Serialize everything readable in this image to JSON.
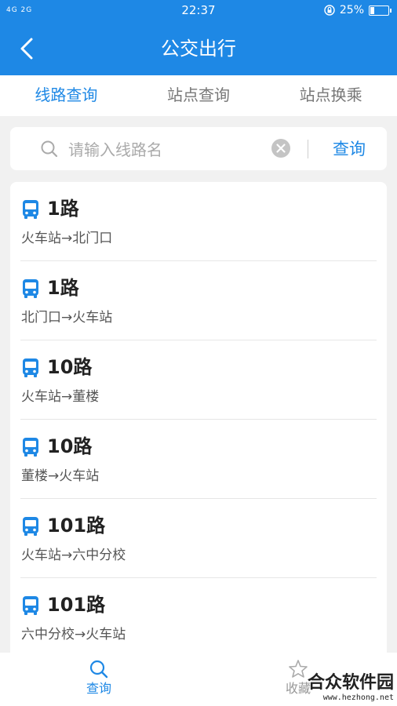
{
  "status_bar": {
    "signal_text": "4G 2G",
    "time": "22:37",
    "battery_percent_text": "25%",
    "battery_level": 0.25
  },
  "header": {
    "title": "公交出行"
  },
  "tabs": [
    {
      "label": "线路查询",
      "active": true
    },
    {
      "label": "站点查询",
      "active": false
    },
    {
      "label": "站点换乘",
      "active": false
    }
  ],
  "search": {
    "placeholder": "请输入线路名",
    "value": "",
    "button_label": "查询"
  },
  "routes": [
    {
      "name": "1路",
      "direction": "火车站→北门口"
    },
    {
      "name": "1路",
      "direction": "北门口→火车站"
    },
    {
      "name": "10路",
      "direction": "火车站→董楼"
    },
    {
      "name": "10路",
      "direction": "董楼→火车站"
    },
    {
      "name": "101路",
      "direction": "火车站→六中分校"
    },
    {
      "name": "101路",
      "direction": "六中分校→火车站"
    }
  ],
  "bottom_nav": [
    {
      "label": "查询",
      "icon": "search-icon",
      "active": true
    },
    {
      "label": "收藏",
      "icon": "star-icon",
      "active": false
    }
  ],
  "watermark": {
    "title": "合众软件园",
    "url": "www.hezhong.net"
  },
  "colors": {
    "primary": "#1e88e5",
    "background": "#f1f1f1"
  }
}
